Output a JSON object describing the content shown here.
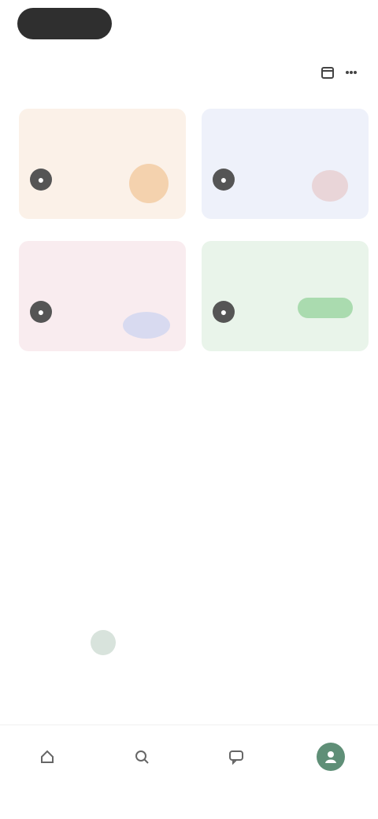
{
  "topbar": {
    "primary_button": "",
    "right_link": ""
  },
  "section": {
    "title": "",
    "filter_link": "",
    "icon_a": "calendar-icon",
    "icon_b": "more-icon"
  },
  "cards": [
    {
      "title": "",
      "subtitle": "",
      "count": "",
      "icon": "user-icon",
      "color": "#fbf1e8",
      "accent": "#f2c79b"
    },
    {
      "title": "",
      "subtitle": "",
      "count": "",
      "icon": "user-icon",
      "color": "#eef1fa",
      "accent": "#e7c9c9"
    },
    {
      "title": "",
      "subtitle": "",
      "count": "",
      "icon": "user-icon",
      "color": "#f9ecef",
      "accent": "#cfd6f0"
    },
    {
      "title": "",
      "subtitle": "",
      "count": "",
      "icon": "user-icon",
      "color": "#e9f4ea",
      "accent": "#9fd6a5"
    }
  ],
  "calendar": {
    "month": "",
    "weekdays": [
      "",
      "",
      "",
      "",
      "",
      "",
      ""
    ],
    "weeks": [
      [
        "",
        "",
        "",
        "",
        "",
        "",
        ""
      ],
      [
        "",
        "",
        "",
        "",
        "",
        "",
        ""
      ],
      [
        "",
        "",
        "",
        "",
        "",
        "",
        ""
      ],
      [
        "",
        "",
        "",
        "",
        "",
        "",
        ""
      ],
      [
        "",
        "",
        "",
        "",
        "",
        "",
        ""
      ],
      [
        "",
        "",
        "",
        "",
        "",
        "",
        ""
      ]
    ],
    "highlight": "#d8e3dc"
  },
  "bottom_nav": {
    "hint": "",
    "items": [
      {
        "label": "",
        "icon": "home-icon"
      },
      {
        "label": "",
        "icon": "search-icon"
      },
      {
        "label": "",
        "icon": "chat-icon"
      },
      {
        "label": "",
        "icon": "profile-icon"
      }
    ],
    "active_index": 3,
    "accent": "#5f8f77"
  }
}
